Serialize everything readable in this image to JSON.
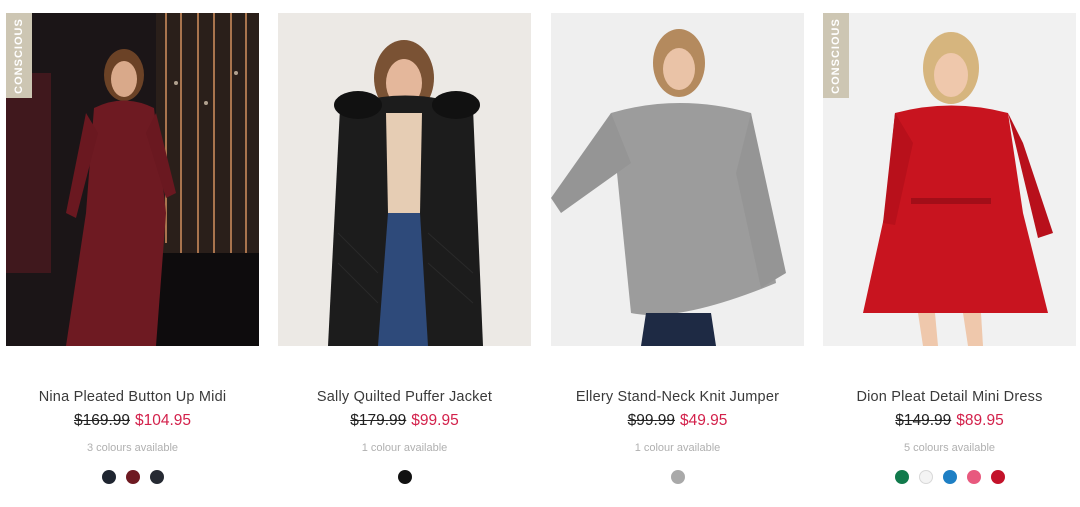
{
  "products": [
    {
      "name": "Nina Pleated Button Up Midi",
      "was_price": "$169.99",
      "now_price": "$104.95",
      "colours_text": "3 colours available",
      "badge": "CONSCIOUS",
      "swatches": [
        "#1f2530",
        "#6e1a22",
        "#262a33"
      ]
    },
    {
      "name": "Sally Quilted Puffer Jacket",
      "was_price": "$179.99",
      "now_price": "$99.95",
      "colours_text": "1 colour available",
      "badge": "",
      "swatches": [
        "#111111"
      ]
    },
    {
      "name": "Ellery Stand-Neck Knit Jumper",
      "was_price": "$99.99",
      "now_price": "$49.95",
      "colours_text": "1 colour available",
      "badge": "",
      "swatches": [
        "#a9a9a9"
      ]
    },
    {
      "name": "Dion Pleat Detail Mini Dress",
      "was_price": "$149.99",
      "now_price": "$89.95",
      "colours_text": "5 colours available",
      "badge": "CONSCIOUS",
      "swatches": [
        "#117a4c",
        "#f4f4f4",
        "#1e7fc4",
        "#e8597e",
        "#c3122a"
      ]
    }
  ]
}
